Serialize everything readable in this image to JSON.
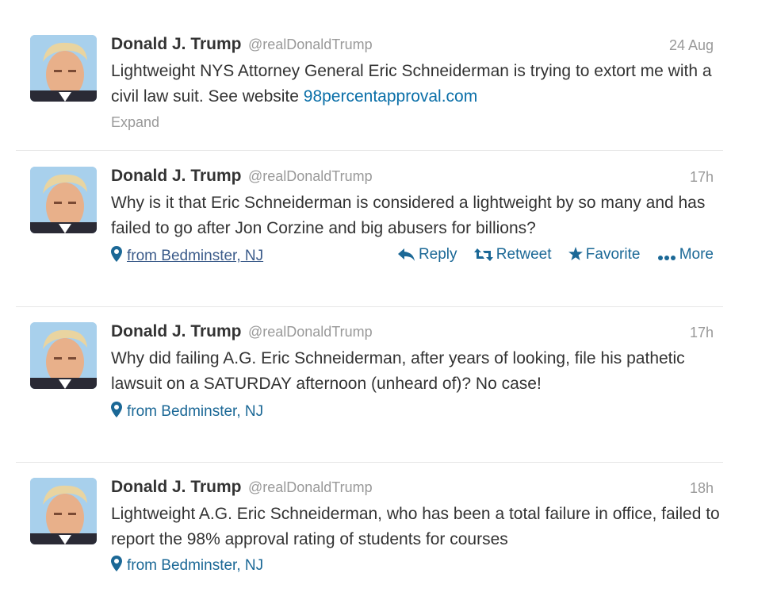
{
  "tweets": [
    {
      "name": "Donald J. Trump",
      "handle": "@realDonaldTrump",
      "time": "24 Aug",
      "text": "Lightweight NYS Attorney General Eric Schneiderman is trying to extort me with a civil law suit. See website ",
      "link": "98percentapproval.com",
      "expand": "Expand"
    },
    {
      "name": "Donald J. Trump",
      "handle": "@realDonaldTrump",
      "time": "17h",
      "text": "Why is it that Eric Schneiderman is considered a lightweight by so many and has failed to go after Jon Corzine and big abusers for billions?",
      "location": "from Bedminster, NJ",
      "actions": {
        "reply": "Reply",
        "retweet": "Retweet",
        "favorite": "Favorite",
        "more": "More"
      }
    },
    {
      "name": "Donald J. Trump",
      "handle": "@realDonaldTrump",
      "time": "17h",
      "text": "Why did failing A.G. Eric Schneiderman, after years of looking, file his pathetic lawsuit on a SATURDAY afternoon (unheard of)? No case!",
      "location": "from Bedminster, NJ"
    },
    {
      "name": "Donald J. Trump",
      "handle": "@realDonaldTrump",
      "time": "18h",
      "text": "Lightweight A.G. Eric Schneiderman, who has been a total failure in office, failed to report the 98% approval rating of students for courses",
      "location": "from Bedminster, NJ"
    }
  ],
  "icons": {
    "avatar": "avatar-photo",
    "location": "map-pin-icon",
    "reply": "reply-arrow-icon",
    "retweet": "retweet-icon",
    "favorite": "star-icon",
    "more": "ellipsis-icon"
  },
  "colors": {
    "link": "#0a6fa8",
    "action": "#1b6896",
    "muted": "#999999",
    "text": "#333333"
  }
}
